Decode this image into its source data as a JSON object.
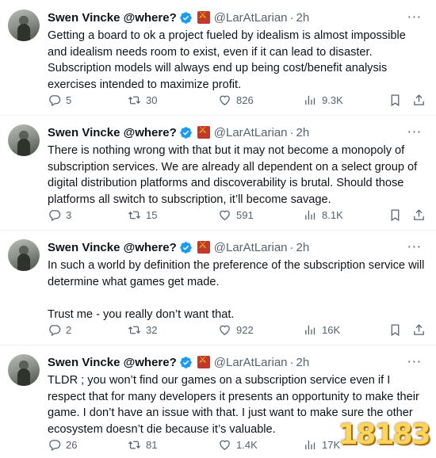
{
  "tweets": [
    {
      "name": "Swen Vincke @where?",
      "handle": "@LarAtLarian",
      "time": "2h",
      "text": "Getting a board to ok a project fueled by idealism is almost impossible and idealism needs room to exist, even if it can lead to disaster. Subscription models will always end up being cost/benefit analysis exercises intended to maximize profit.",
      "replies": "5",
      "retweets": "30",
      "likes": "826",
      "views": "9.3K"
    },
    {
      "name": "Swen Vincke @where?",
      "handle": "@LarAtLarian",
      "time": "2h",
      "text": "There is nothing wrong with that but it may not become a monopoly of subscription services. We are already all dependent on a select group of digital distribution platforms and discoverability is brutal. Should those platforms all switch to subscription, it’ll become savage.",
      "replies": "3",
      "retweets": "15",
      "likes": "591",
      "views": "8.1K"
    },
    {
      "name": "Swen Vincke @where?",
      "handle": "@LarAtLarian",
      "time": "2h",
      "text": "In such a world by definition the preference of the subscription service will determine what games get made.\n\nTrust me - you really don’t want that.",
      "replies": "2",
      "retweets": "32",
      "likes": "922",
      "views": "16K"
    },
    {
      "name": "Swen Vincke @where?",
      "handle": "@LarAtLarian",
      "time": "2h",
      "text": "TLDR ; you won’t find our games on a subscription service even if I respect that for many developers it presents an opportunity to make their game. I don’t have an issue with that. I just want to make sure the other ecosystem doesn’t die because it’s valuable.",
      "replies": "26",
      "retweets": "81",
      "likes": "1.4K",
      "views": "17K"
    }
  ],
  "separator": "·",
  "more": "···",
  "watermark": "18183",
  "colors": {
    "text": "#0f1419",
    "muted": "#536471",
    "verified": "#1d9bf0"
  }
}
